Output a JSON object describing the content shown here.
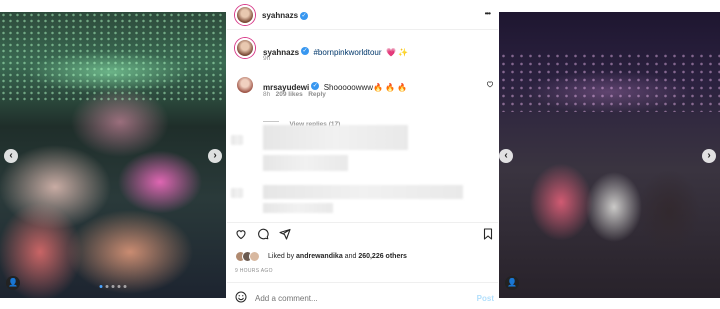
{
  "left_photo": {
    "arrow_left": "‹",
    "arrow_right": "›",
    "person": "👤"
  },
  "right_photo": {
    "arrow_left": "‹",
    "arrow_right": "›",
    "person": "👤"
  },
  "post": {
    "header_username": "syahnazs",
    "more": "•••",
    "caption": {
      "username": "syahnazs",
      "hashtag": "#bornpinkworldtour",
      "emojis": "💗 ✨",
      "time": "9h"
    },
    "comment": {
      "username": "mrsayudewi",
      "text": "Shooooowww🔥 🔥 🔥",
      "time": "8h",
      "likes": "209 likes",
      "reply": "Reply",
      "view_replies": "View replies (17)"
    },
    "likes_prefix": "Liked by",
    "liked_by_user": "andrewandika",
    "likes_joiner": "and",
    "likes_count": "260,226 others",
    "timestamp": "9 HOURS AGO",
    "add_comment_placeholder": "Add a comment...",
    "post_button": "Post"
  },
  "colors": {
    "accent": "#3897f0",
    "verified": "#3897f0",
    "hashtag": "#00376b",
    "story_ring": "#d83a8a"
  }
}
